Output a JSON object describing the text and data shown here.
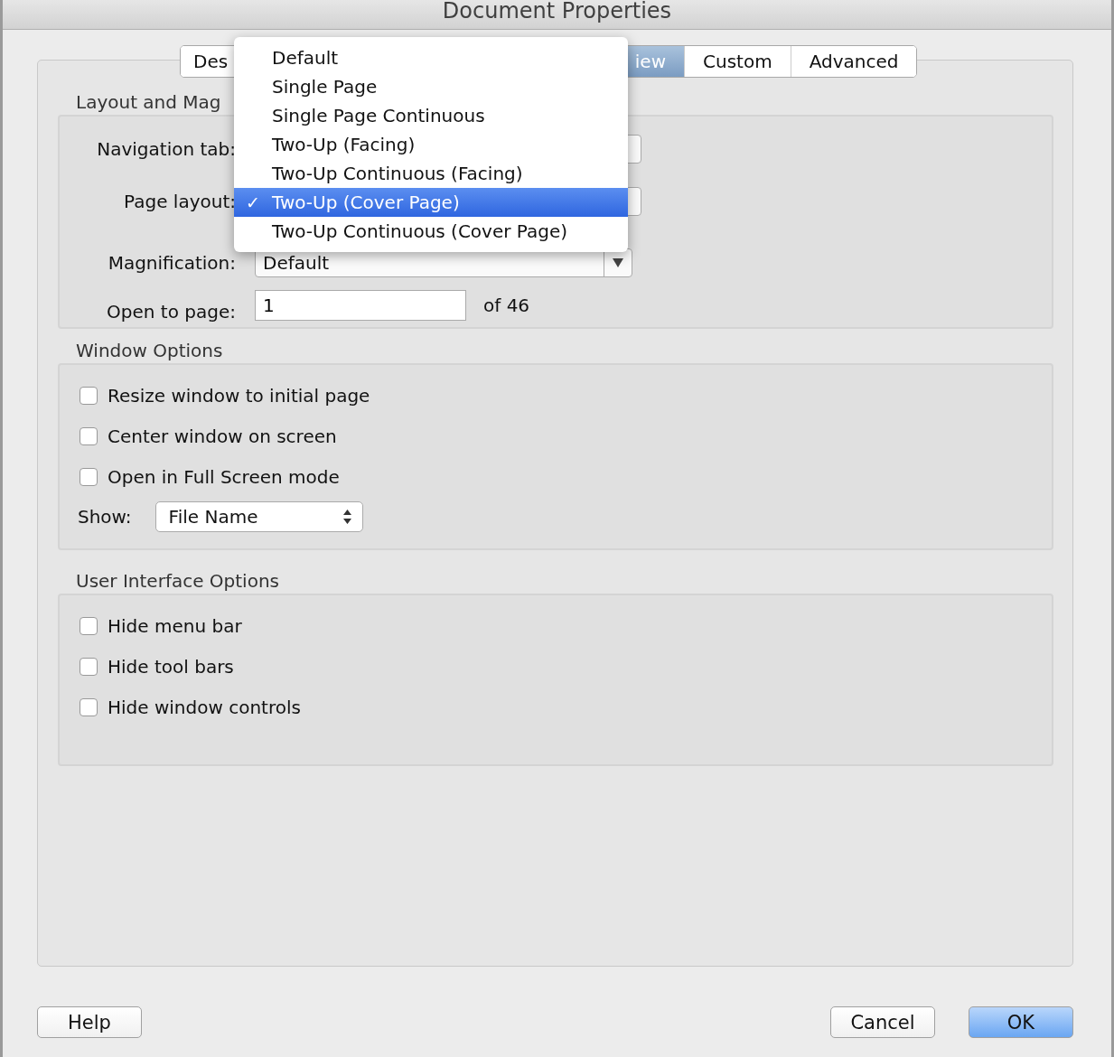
{
  "window": {
    "title": "Document Properties"
  },
  "tabs": [
    {
      "label": "Des",
      "selected": false
    },
    {
      "label": "iew",
      "selected": true
    },
    {
      "label": "Custom",
      "selected": false
    },
    {
      "label": "Advanced",
      "selected": false
    }
  ],
  "layout_section": {
    "title": "Layout and Mag",
    "fields": [
      {
        "kind": "select",
        "label": "Navigation tab:"
      },
      {
        "kind": "select",
        "label": "Page layout:"
      },
      {
        "kind": "select",
        "label": "Magnification:",
        "value": "Default"
      },
      {
        "kind": "text",
        "label": "Open to page:",
        "value": "1",
        "suffix": "of 46"
      }
    ]
  },
  "layout_menu": [
    {
      "label": "Default",
      "selected": false
    },
    {
      "label": "Single Page",
      "selected": false
    },
    {
      "label": "Single Page Continuous",
      "selected": false
    },
    {
      "label": "Two-Up (Facing)",
      "selected": false
    },
    {
      "label": "Two-Up Continuous (Facing)",
      "selected": false
    },
    {
      "label": "Two-Up (Cover Page)",
      "selected": true,
      "mark": "✓"
    },
    {
      "label": "Two-Up Continuous (Cover Page)",
      "selected": false
    }
  ],
  "window_options": {
    "title": "Window Options",
    "checkboxes": [
      {
        "label": "Resize window to initial page",
        "checked": false
      },
      {
        "label": "Center window on screen",
        "checked": false
      },
      {
        "label": "Open in Full Screen mode",
        "checked": false
      }
    ],
    "show": {
      "label": "Show:",
      "value": "File Name"
    }
  },
  "ui_options": {
    "title": "User Interface Options",
    "checkboxes": [
      {
        "label": "Hide menu bar",
        "checked": false
      },
      {
        "label": "Hide tool bars",
        "checked": false
      },
      {
        "label": "Hide window controls",
        "checked": false
      }
    ]
  },
  "buttons": [
    {
      "label": "Help",
      "default": false
    },
    {
      "label": "Cancel",
      "default": false
    },
    {
      "label": "OK",
      "default": true
    }
  ]
}
